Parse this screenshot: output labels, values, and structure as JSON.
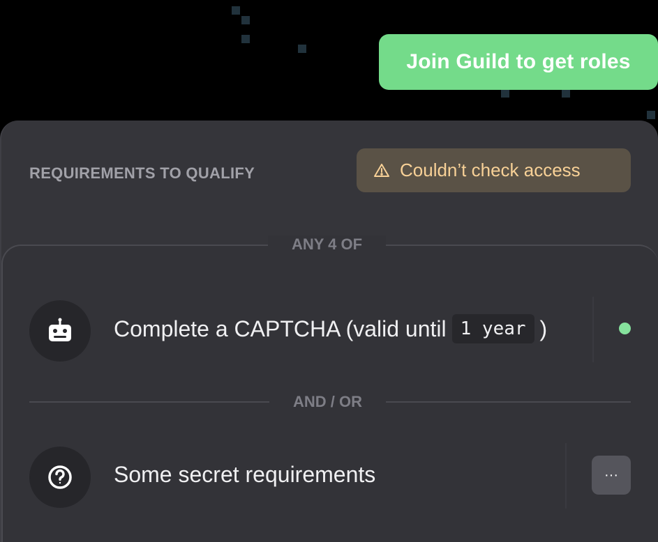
{
  "header": {
    "join_button_label": "Join Guild to get roles"
  },
  "requirements": {
    "title": "REQUIREMENTS TO QUALIFY",
    "access_status": "Couldn’t check access",
    "logic_label": "ANY 4 OF",
    "separator_label": "AND / OR",
    "items": [
      {
        "icon": "robot-icon",
        "text_prefix": "Complete a CAPTCHA (valid until",
        "code": "1 year",
        "text_suffix": ")",
        "status": "satisfied",
        "status_color": "#86e29d"
      },
      {
        "icon": "question-circle-icon",
        "text": "Some secret requirements",
        "more_label": "···"
      }
    ]
  },
  "colors": {
    "accent_green": "#74db8a",
    "warning_text": "#f8d197",
    "warning_bg": "#5a5246"
  }
}
